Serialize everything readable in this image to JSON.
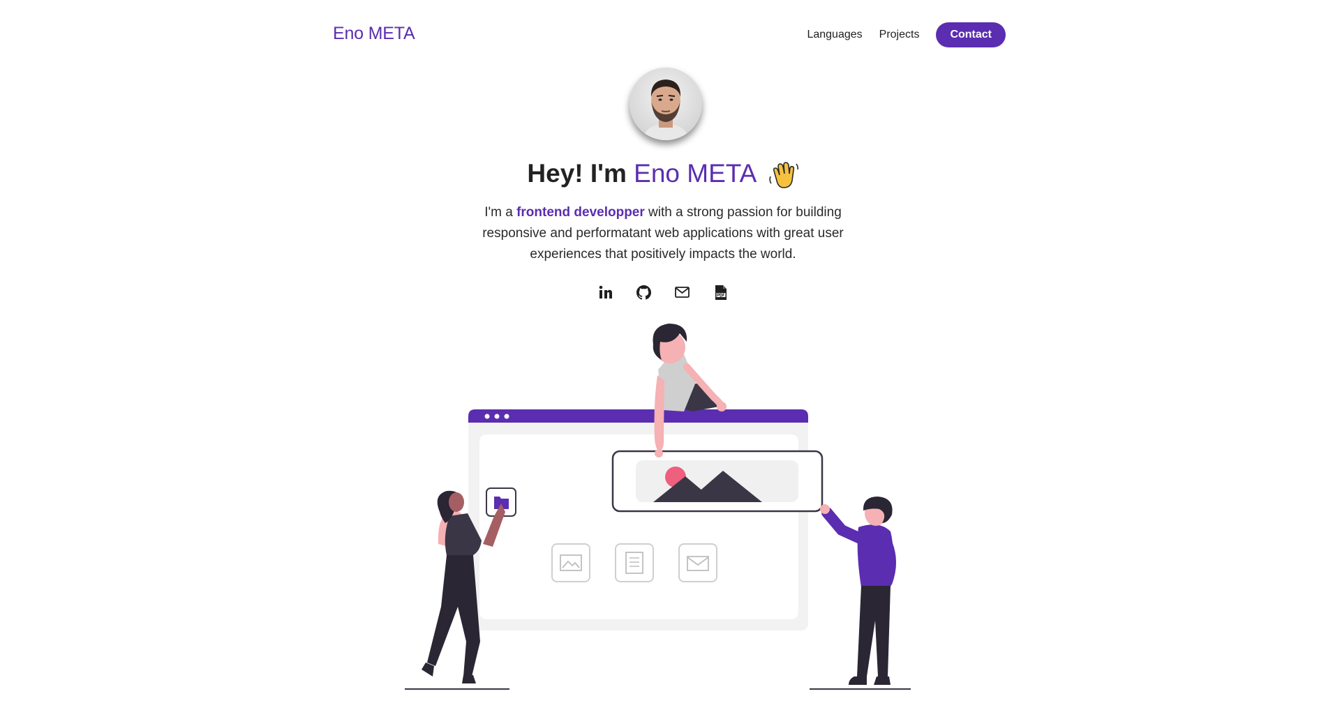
{
  "header": {
    "logo": "Eno META",
    "nav": [
      {
        "label": "Languages"
      },
      {
        "label": "Projects"
      }
    ],
    "contact_label": "Contact"
  },
  "hero": {
    "title_prefix": "Hey! I'm ",
    "title_name": "Eno META",
    "intro_prefix": "I'm a ",
    "intro_highlight": "frontend developper",
    "intro_rest": " with a strong passion for building responsive and performatant web applications with great user experiences that positively impacts the world."
  },
  "socials": [
    {
      "icon": "linkedin-icon"
    },
    {
      "icon": "github-icon"
    },
    {
      "icon": "mail-icon"
    },
    {
      "icon": "pdf-icon"
    }
  ],
  "colors": {
    "accent": "#5b2db0",
    "text": "#1f1f1f"
  }
}
